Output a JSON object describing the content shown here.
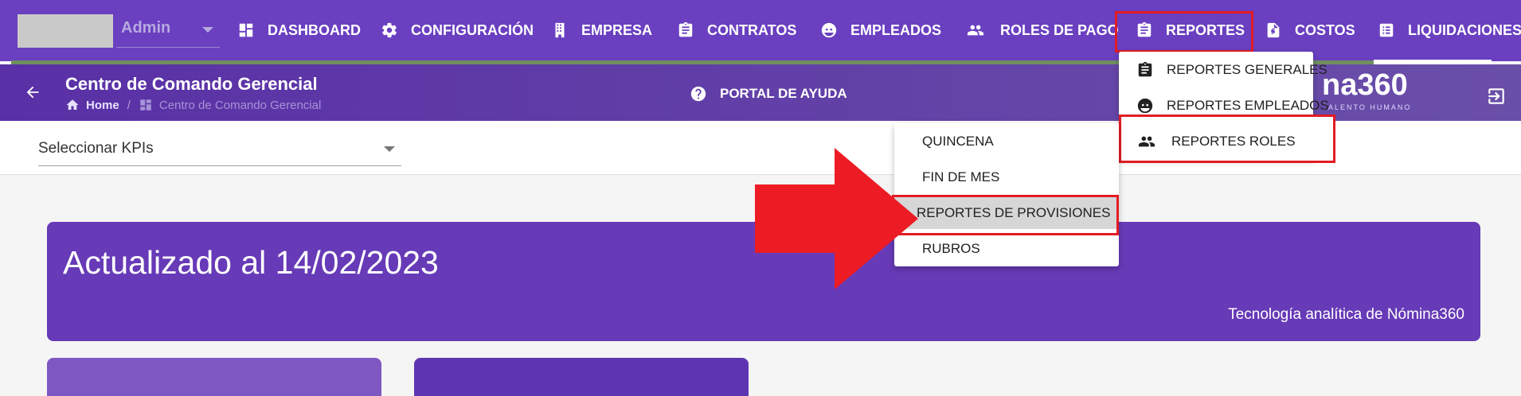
{
  "user": {
    "name": "Admin"
  },
  "nav": {
    "items": [
      {
        "label": "DASHBOARD",
        "icon": "dashboard-icon"
      },
      {
        "label": "CONFIGURACIÓN",
        "icon": "gear-icon"
      },
      {
        "label": "EMPRESA",
        "icon": "building-icon"
      },
      {
        "label": "CONTRATOS",
        "icon": "clipboard-icon"
      },
      {
        "label": "EMPLEADOS",
        "icon": "face-icon"
      },
      {
        "label": "ROLES DE PAGO",
        "icon": "people-icon"
      },
      {
        "label": "REPORTES",
        "icon": "clipboard-icon"
      },
      {
        "label": "COSTOS",
        "icon": "invoice-icon"
      },
      {
        "label": "LIQUIDACIONES",
        "icon": "list-icon"
      }
    ]
  },
  "header": {
    "title": "Centro de Comando Gerencial",
    "breadcrumb": {
      "home": "Home",
      "current": "Centro de Comando Gerencial"
    },
    "help": "PORTAL DE AYUDA",
    "brand": "na360",
    "brand_sub": "ALENTO HUMANO"
  },
  "kpi": {
    "placeholder": "Seleccionar KPIs"
  },
  "hero": {
    "title": "Actualizado al 14/02/2023",
    "subtitle": "Tecnología analítica de Nómina360"
  },
  "reportes_menu": {
    "items": [
      {
        "label": "REPORTES GENERALES",
        "icon": "clipboard-icon"
      },
      {
        "label": "REPORTES EMPLEADOS",
        "icon": "face-icon"
      },
      {
        "label": "REPORTES ROLES",
        "icon": "people-icon"
      }
    ]
  },
  "roles_submenu": {
    "items": [
      {
        "label": "QUINCENA"
      },
      {
        "label": "FIN DE MES"
      },
      {
        "label": "REPORTES DE PROVISIONES"
      },
      {
        "label": "RUBROS"
      }
    ]
  },
  "colors": {
    "nav_bg": "#6a3fc0",
    "hero_bg": "#673ab7",
    "highlight": "#e31b23"
  }
}
